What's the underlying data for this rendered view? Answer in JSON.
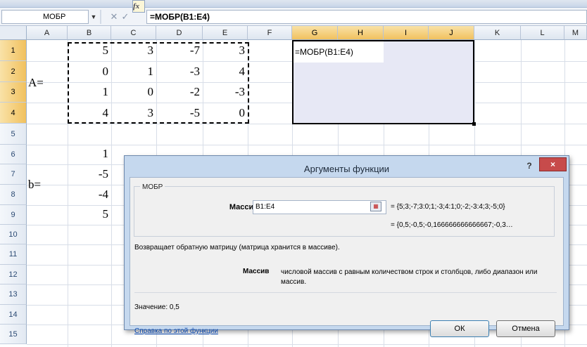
{
  "formula_bar": {
    "name_box": "МОБР",
    "formula": "=МОБР(B1:E4)"
  },
  "columns": [
    "A",
    "B",
    "C",
    "D",
    "E",
    "F",
    "G",
    "H",
    "I",
    "J",
    "K",
    "L",
    "M"
  ],
  "rows": [
    "1",
    "2",
    "3",
    "4",
    "5",
    "6",
    "7",
    "8",
    "9",
    "10",
    "11",
    "12",
    "13",
    "14",
    "15"
  ],
  "cells": {
    "a_label": "A=",
    "b_label": "b=",
    "matrix": [
      [
        "5",
        "3",
        "-7",
        "3"
      ],
      [
        "0",
        "1",
        "-3",
        "4"
      ],
      [
        "1",
        "0",
        "-2",
        "-3"
      ],
      [
        "4",
        "3",
        "-5",
        "0"
      ]
    ],
    "vector": [
      "1",
      "-5",
      "-4",
      "5"
    ],
    "g1": "=МОБР(B1:E4)"
  },
  "dialog": {
    "title": "Аргументы функции",
    "help": "?",
    "close": "×",
    "group_title": "МОБР",
    "arg_label": "Массив",
    "arg_input": "B1:E4",
    "arg_value": "=  {5;3;-7;3:0;1;-3;4:1;0;-2;-3:4;3;-5;0}",
    "result_preview": "=  {0,5;-0,5;-0,166666666666667;-0,3…",
    "description": "Возвращает обратную матрицу (матрица хранится в массиве).",
    "arg_desc_label": "Массив",
    "arg_desc": "числовой массив с равным количеством строк и столбцов, либо диапазон или массив.",
    "value_line": "Значение:  0,5",
    "help_link": "Справка по этой функции",
    "ok": "ОК",
    "cancel": "Отмена"
  }
}
